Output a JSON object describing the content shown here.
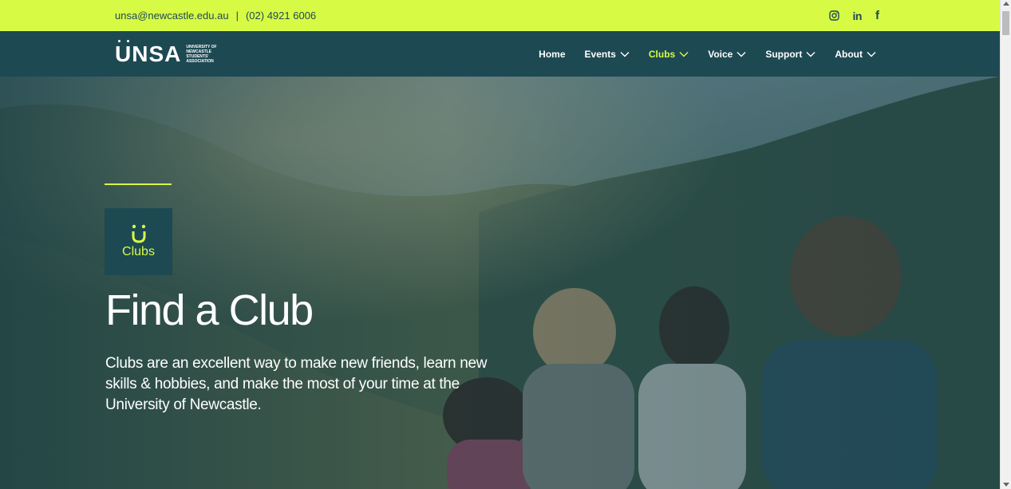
{
  "topbar": {
    "email": "unsa@newcastle.edu.au",
    "separator": "|",
    "phone": "(02) 4921 6006",
    "socials": [
      {
        "icon": "instagram-icon"
      },
      {
        "icon": "linkedin-icon",
        "text": "in"
      },
      {
        "icon": "facebook-icon",
        "text": "f"
      }
    ]
  },
  "header": {
    "logo": {
      "word": "UNSA",
      "subtitle": "University of Newcastle Students' Association"
    },
    "nav": [
      {
        "label": "Home",
        "dropdown": false,
        "active": false
      },
      {
        "label": "Events",
        "dropdown": true,
        "active": false
      },
      {
        "label": "Clubs",
        "dropdown": true,
        "active": true
      },
      {
        "label": "Voice",
        "dropdown": true,
        "active": false
      },
      {
        "label": "Support",
        "dropdown": true,
        "active": false
      },
      {
        "label": "About",
        "dropdown": true,
        "active": false
      }
    ]
  },
  "hero": {
    "badge_label": "Clubs",
    "title": "Find a Club",
    "description": "Clubs are an excellent way to make new friends, learn new skills & hobbies, and make the most of your time at the University of Newcastle."
  },
  "colors": {
    "accent": "#d7fa45",
    "brand_dark": "#1d4953"
  }
}
